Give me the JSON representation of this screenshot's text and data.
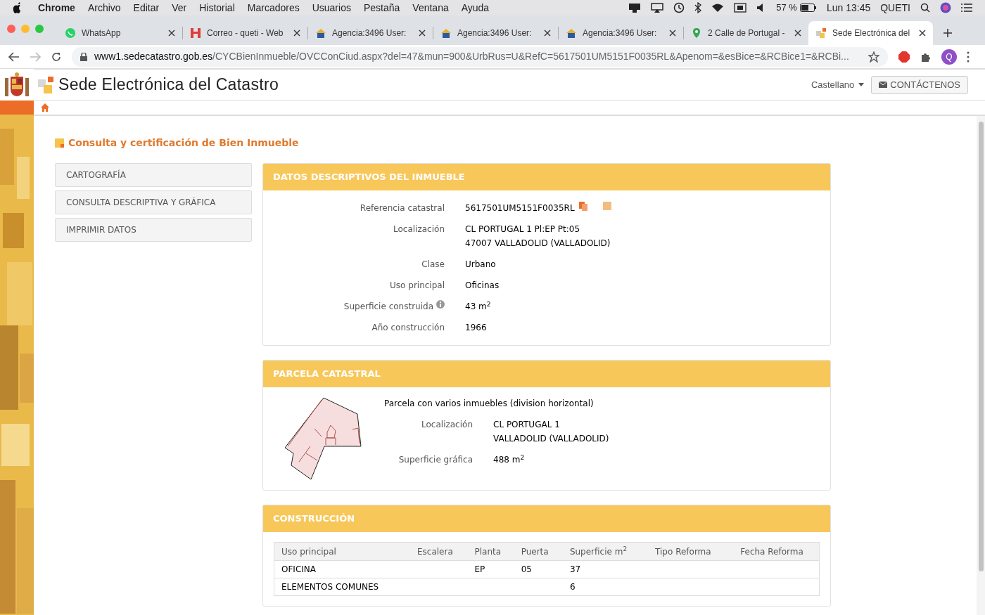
{
  "menubar": {
    "app": "Chrome",
    "menus": [
      "Archivo",
      "Editar",
      "Ver",
      "Historial",
      "Marcadores",
      "Usuarios",
      "Pestaña",
      "Ventana",
      "Ayuda"
    ],
    "battery": "57 %",
    "clock": "Lun 13:45",
    "user": "QUETI"
  },
  "tabs": [
    {
      "kind": "whatsapp",
      "title": "WhatsApp",
      "selected": false
    },
    {
      "kind": "mail",
      "title": "Correo - queti - Web",
      "selected": false
    },
    {
      "kind": "agency",
      "title": "Agencia:3496 User:",
      "selected": false
    },
    {
      "kind": "agency",
      "title": "Agencia:3496 User:",
      "selected": false
    },
    {
      "kind": "agency",
      "title": "Agencia:3496 User:",
      "selected": false
    },
    {
      "kind": "maps",
      "title": "2 Calle de Portugal -",
      "selected": false
    },
    {
      "kind": "catastro",
      "title": "Sede Electrónica del",
      "selected": true
    }
  ],
  "address": {
    "domain": "www1.sedecatastro.gob.es",
    "path": "/CYCBienInmueble/OVCConCiud.aspx?del=47&mun=900&UrbRus=U&RefC=5617501UM5151F0035RL&Apenom=&esBice=&RCBice1=&RCBi...",
    "profile": "Q"
  },
  "site": {
    "title": "Sede Electrónica del Catastro",
    "language": "Castellano",
    "contact": "CONTÁCTENOS"
  },
  "page_title": "Consulta y certificación de Bien Inmueble",
  "side_menu": [
    "CARTOGRAFÍA",
    "CONSULTA DESCRIPTIVA Y GRÁFICA",
    "IMPRIMIR DATOS"
  ],
  "datos": {
    "title": "DATOS DESCRIPTIVOS DEL INMUEBLE",
    "rows": [
      {
        "kind": "reference",
        "label": "Referencia catastral",
        "value": [
          "5617501UM5151F0035RL"
        ]
      },
      {
        "kind": "plain",
        "label": "Localización",
        "value": [
          "CL PORTUGAL 1 Pl:EP Pt:05",
          "47007 VALLADOLID (VALLADOLID)"
        ]
      },
      {
        "kind": "plain",
        "label": "Clase",
        "value": [
          "Urbano"
        ]
      },
      {
        "kind": "plain",
        "label": "Uso principal",
        "value": [
          "Oficinas"
        ]
      },
      {
        "kind": "info",
        "label": "Superficie construida",
        "value": [
          "43 m$^{2}$"
        ]
      },
      {
        "kind": "plain",
        "label": "Año construcción",
        "value": [
          "1966"
        ]
      }
    ]
  },
  "parcela": {
    "title": "PARCELA CATASTRAL",
    "description": "Parcela con varios inmuebles (division horizontal)",
    "rows": [
      {
        "label": "Localización",
        "value": [
          "CL PORTUGAL 1",
          "VALLADOLID (VALLADOLID)"
        ]
      },
      {
        "label": "Superficie gráfica",
        "value": [
          "488 m$^{2}$"
        ]
      }
    ]
  },
  "construccion": {
    "title": "CONSTRUCCIÓN",
    "columns": [
      "Uso principal",
      "Escalera",
      "Planta",
      "Puerta",
      "Superficie m$^{2}$",
      "Tipo Reforma",
      "Fecha Reforma"
    ],
    "rows": [
      [
        "OFICINA",
        "",
        "EP",
        "05",
        "37",
        "",
        ""
      ],
      [
        "ELEMENTOS COMUNES",
        "",
        "",
        "",
        "6",
        "",
        ""
      ]
    ]
  }
}
